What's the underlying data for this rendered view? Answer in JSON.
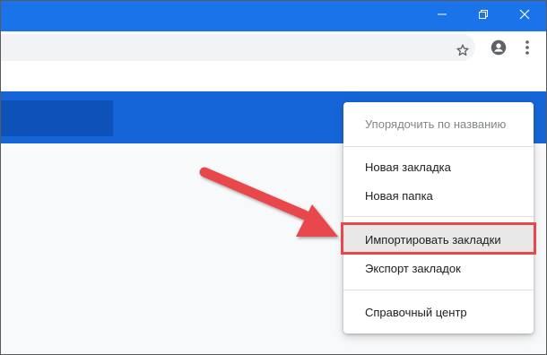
{
  "window": {
    "minimize_icon": "minimize-icon",
    "maximize_icon": "restore-icon",
    "close_icon": "close-icon"
  },
  "toolbar": {
    "star_icon": "star-icon",
    "profile_icon": "account-icon",
    "menu_icon": "more-vert-icon"
  },
  "menu": {
    "items": [
      {
        "label": "Упорядочить по названию",
        "disabled": true
      },
      {
        "label": "Новая закладка",
        "disabled": false
      },
      {
        "label": "Новая папка",
        "disabled": false
      },
      {
        "label": "Импортировать закладки",
        "disabled": false,
        "highlighted": true
      },
      {
        "label": "Экспорт закладок",
        "disabled": false
      },
      {
        "label": "Справочный центр",
        "disabled": false
      }
    ]
  },
  "colors": {
    "titlebar": "#1a73e8",
    "header": "#1565d8",
    "annotation": "#e8474b"
  }
}
